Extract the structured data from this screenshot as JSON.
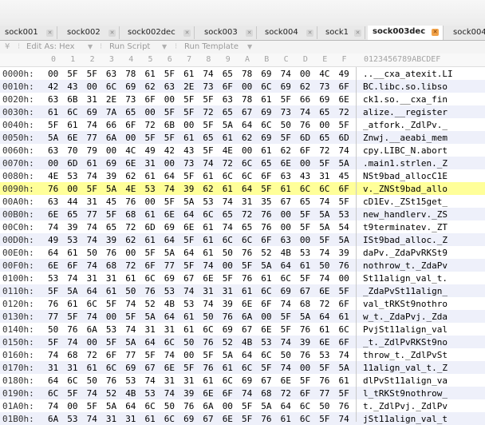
{
  "tabs": [
    {
      "label": "sock001",
      "active": false
    },
    {
      "label": "sock002",
      "active": false
    },
    {
      "label": "sock002dec",
      "active": false
    },
    {
      "label": "sock003",
      "active": false
    },
    {
      "label": "sock004",
      "active": false
    },
    {
      "label": "sock1",
      "active": false
    },
    {
      "label": "sock003dec",
      "active": true
    },
    {
      "label": "sock004",
      "active": false
    }
  ],
  "toolbar": {
    "edit_as_label": "Edit As: Hex",
    "run_script_label": "Run Script",
    "run_template_label": "Run Template"
  },
  "ruler": {
    "hex_columns": [
      "0",
      "1",
      "2",
      "3",
      "4",
      "5",
      "6",
      "7",
      "8",
      "9",
      "A",
      "B",
      "C",
      "D",
      "E",
      "F"
    ],
    "ascii_header": "0123456789ABCDEF"
  },
  "rows": [
    {
      "addr": "0000h:",
      "hex": "00 5F 5F 63 78 61 5F 61 74 65 78 69 74 00 4C 49",
      "ascii": "..__cxa_atexit.LI"
    },
    {
      "addr": "0010h:",
      "hex": "42 43 00 6C 69 62 63 2E 73 6F 00 6C 69 62 73 6F",
      "ascii": "BC.libc.so.libso"
    },
    {
      "addr": "0020h:",
      "hex": "63 6B 31 2E 73 6F 00 5F 5F 63 78 61 5F 66 69 6E",
      "ascii": "ck1.so.__cxa_fin"
    },
    {
      "addr": "0030h:",
      "hex": "61 6C 69 7A 65 00 5F 5F 72 65 67 69 73 74 65 72",
      "ascii": "alize.__register"
    },
    {
      "addr": "0040h:",
      "hex": "5F 61 74 66 6F 72 6B 00 5F 5A 64 6C 50 76 00 5F",
      "ascii": "_atfork._ZdlPv._"
    },
    {
      "addr": "0050h:",
      "hex": "5A 6E 77 6A 00 5F 5F 61 65 61 62 69 5F 6D 65 6D",
      "ascii": "Znwj.__aeabi_mem"
    },
    {
      "addr": "0060h:",
      "hex": "63 70 79 00 4C 49 42 43 5F 4E 00 61 62 6F 72 74",
      "ascii": "cpy.LIBC_N.abort"
    },
    {
      "addr": "0070h:",
      "hex": "00 6D 61 69 6E 31 00 73 74 72 6C 65 6E 00 5F 5A",
      "ascii": ".main1.strlen._Z"
    },
    {
      "addr": "0080h:",
      "hex": "4E 53 74 39 62 61 64 5F 61 6C 6C 6F 63 43 31 45",
      "ascii": "NSt9bad_allocC1E"
    },
    {
      "addr": "0090h:",
      "hex": "76 00 5F 5A 4E 53 74 39 62 61 64 5F 61 6C 6C 6F",
      "ascii": "v._ZNSt9bad_allo"
    },
    {
      "addr": "00A0h:",
      "hex": "63 44 31 45 76 00 5F 5A 53 74 31 35 67 65 74 5F",
      "ascii": "cD1Ev._ZSt15get_"
    },
    {
      "addr": "00B0h:",
      "hex": "6E 65 77 5F 68 61 6E 64 6C 65 72 76 00 5F 5A 53",
      "ascii": "new_handlerv._ZS"
    },
    {
      "addr": "00C0h:",
      "hex": "74 39 74 65 72 6D 69 6E 61 74 65 76 00 5F 5A 54",
      "ascii": "t9terminatev._ZT"
    },
    {
      "addr": "00D0h:",
      "hex": "49 53 74 39 62 61 64 5F 61 6C 6C 6F 63 00 5F 5A",
      "ascii": "ISt9bad_alloc._Z"
    },
    {
      "addr": "00E0h:",
      "hex": "64 61 50 76 00 5F 5A 64 61 50 76 52 4B 53 74 39",
      "ascii": "daPv._ZdaPvRKSt9"
    },
    {
      "addr": "00F0h:",
      "hex": "6E 6F 74 68 72 6F 77 5F 74 00 5F 5A 64 61 50 76",
      "ascii": "nothrow_t._ZdaPv"
    },
    {
      "addr": "0100h:",
      "hex": "53 74 31 31 61 6C 69 67 6E 5F 76 61 6C 5F 74 00",
      "ascii": "St11align_val_t."
    },
    {
      "addr": "0110h:",
      "hex": "5F 5A 64 61 50 76 53 74 31 31 61 6C 69 67 6E 5F",
      "ascii": "_ZdaPvSt11align_"
    },
    {
      "addr": "0120h:",
      "hex": "76 61 6C 5F 74 52 4B 53 74 39 6E 6F 74 68 72 6F",
      "ascii": "val_tRKSt9nothro"
    },
    {
      "addr": "0130h:",
      "hex": "77 5F 74 00 5F 5A 64 61 50 76 6A 00 5F 5A 64 61",
      "ascii": "w_t._ZdaPvj._Zda"
    },
    {
      "addr": "0140h:",
      "hex": "50 76 6A 53 74 31 31 61 6C 69 67 6E 5F 76 61 6C",
      "ascii": "PvjSt11align_val"
    },
    {
      "addr": "0150h:",
      "hex": "5F 74 00 5F 5A 64 6C 50 76 52 4B 53 74 39 6E 6F",
      "ascii": "_t._ZdlPvRKSt9no"
    },
    {
      "addr": "0160h:",
      "hex": "74 68 72 6F 77 5F 74 00 5F 5A 64 6C 50 76 53 74",
      "ascii": "throw_t._ZdlPvSt"
    },
    {
      "addr": "0170h:",
      "hex": "31 31 61 6C 69 67 6E 5F 76 61 6C 5F 74 00 5F 5A",
      "ascii": "11align_val_t._Z"
    },
    {
      "addr": "0180h:",
      "hex": "64 6C 50 76 53 74 31 31 61 6C 69 67 6E 5F 76 61",
      "ascii": "dlPvSt11align_va"
    },
    {
      "addr": "0190h:",
      "hex": "6C 5F 74 52 4B 53 74 39 6E 6F 74 68 72 6F 77 5F",
      "ascii": "l_tRKSt9nothrow_"
    },
    {
      "addr": "01A0h:",
      "hex": "74 00 5F 5A 64 6C 50 76 6A 00 5F 5A 64 6C 50 76",
      "ascii": "t._ZdlPvj._ZdlPv"
    },
    {
      "addr": "01B0h:",
      "hex": "6A 53 74 31 31 61 6C 69 67 6E 5F 76 61 6C 5F 74",
      "ascii": "jSt11align_val_t"
    }
  ],
  "highlight_row_index": 9,
  "colors": {
    "highlight": "#ffff99",
    "alt_row": "#eef0fa",
    "active_tab_close": "#f2a34a"
  }
}
